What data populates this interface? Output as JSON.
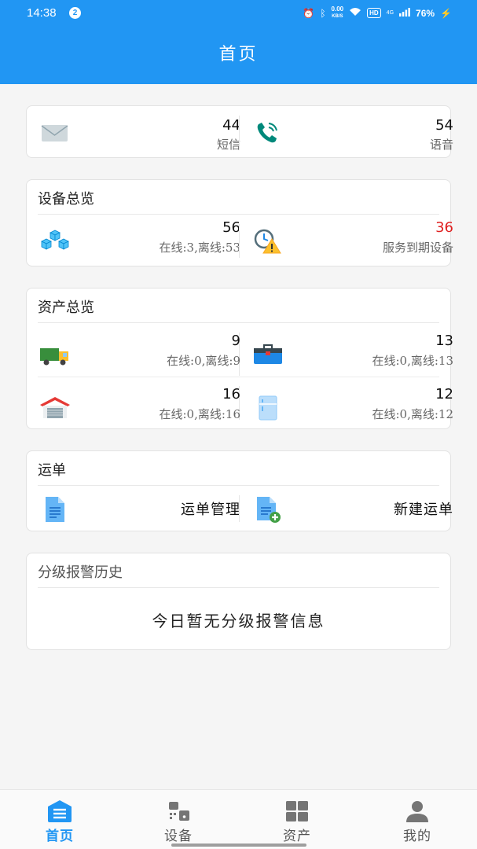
{
  "status_bar": {
    "time": "14:38",
    "notification_count": "2",
    "net_speed_value": "0.00",
    "net_speed_unit": "KB/S",
    "hd": "HD",
    "signal": "4G",
    "battery": "76%"
  },
  "header": {
    "title": "首页"
  },
  "messages": {
    "sms": {
      "count": "44",
      "label": "短信",
      "icon": "mail-icon"
    },
    "voice": {
      "count": "54",
      "label": "语音",
      "icon": "phone-icon"
    }
  },
  "device_overview": {
    "title": "设备总览",
    "total": {
      "count": "56",
      "detail": "在线:3,离线:53",
      "icon": "devices-cubes-icon"
    },
    "expiring": {
      "count": "36",
      "label": "服务到期设备",
      "icon": "clock-warning-icon",
      "color": "#e02020"
    }
  },
  "asset_overview": {
    "title": "资产总览",
    "items": [
      {
        "count": "9",
        "detail": "在线:0,离线:9",
        "icon": "truck-icon"
      },
      {
        "count": "13",
        "detail": "在线:0,离线:13",
        "icon": "toolbox-icon"
      },
      {
        "count": "16",
        "detail": "在线:0,离线:16",
        "icon": "warehouse-icon"
      },
      {
        "count": "12",
        "detail": "在线:0,离线:12",
        "icon": "refrigerator-icon"
      }
    ]
  },
  "waybill": {
    "title": "运单",
    "manage_label": "运单管理",
    "create_label": "新建运单"
  },
  "alarm_history": {
    "title": "分级报警历史",
    "empty_text": "今日暂无分级报警信息"
  },
  "tabs": [
    {
      "label": "首页",
      "icon": "home-list-icon",
      "active": true
    },
    {
      "label": "设备",
      "icon": "device-icon",
      "active": false
    },
    {
      "label": "资产",
      "icon": "grid-icon",
      "active": false
    },
    {
      "label": "我的",
      "icon": "user-icon",
      "active": false
    }
  ],
  "colors": {
    "primary": "#2196f3",
    "alert": "#e02020",
    "background": "#f5f5f5"
  }
}
